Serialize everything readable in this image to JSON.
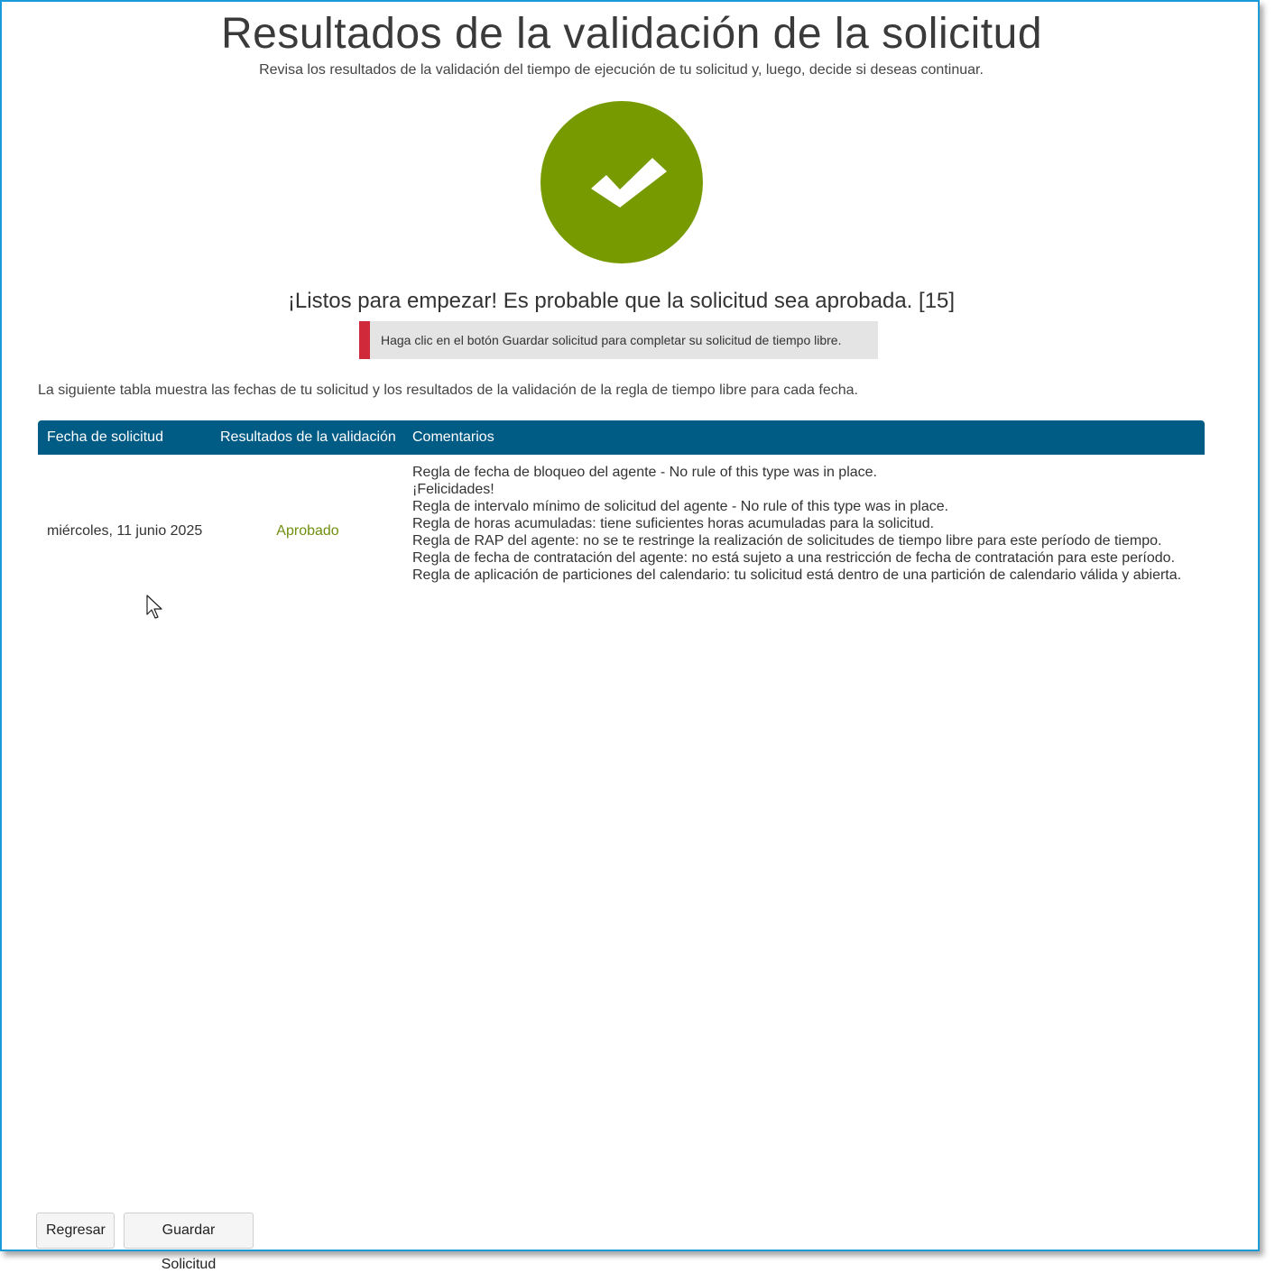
{
  "page": {
    "title": "Resultados de la validación de la solicitud",
    "subtitle": "Revisa los resultados de la validación del tiempo de ejecución de tu solicitud y, luego, decide si deseas continuar."
  },
  "status": {
    "icon": "checkmark-icon",
    "color": "#779a00",
    "message": "¡Listos para empezar! Es probable que la solicitud sea aprobada. [15]"
  },
  "notice": {
    "text": "Haga clic en el botón Guardar solicitud para completar su solicitud de tiempo libre.",
    "accent_color": "#d0293a"
  },
  "intro_text": "La siguiente tabla muestra las fechas de tu solicitud y los resultados de la validación de la regla de tiempo libre para cada fecha.",
  "table": {
    "header_color": "#005b85",
    "headers": [
      "Fecha de solicitud",
      "Resultados de la validación",
      "Comentarios"
    ],
    "rows": [
      {
        "date": "miércoles, 11 junio 2025",
        "result": "Aprobado",
        "comments": [
          "Regla de fecha de bloqueo del agente - No rule of this type was in place.",
          "¡Felicidades!",
          "Regla de intervalo mínimo de solicitud del agente - No rule of this type was in place.",
          "Regla de horas acumuladas: tiene suficientes horas acumuladas para la solicitud.",
          "Regla de RAP del agente: no se te restringe la realización de solicitudes de tiempo libre para este período de tiempo.",
          "Regla de fecha de contratación del agente: no está sujeto a una restricción de fecha de contratación para este período.",
          "Regla de aplicación de particiones del calendario: tu solicitud está dentro de una partición de calendario válida y abierta."
        ]
      }
    ]
  },
  "buttons": {
    "back_label": "Regresar",
    "save_label": "Guardar Solicitud"
  }
}
